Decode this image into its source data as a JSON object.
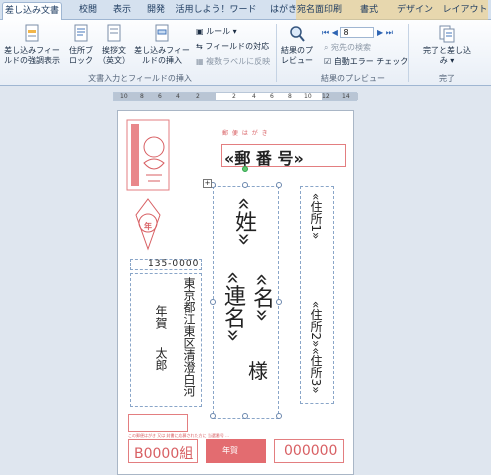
{
  "tabs": [
    "差し込み文書",
    "校閲",
    "表示",
    "開発",
    "活用しよう！ワード",
    "はがき宛名面印刷",
    "書式",
    "デザイン",
    "レイアウト"
  ],
  "ribbon": {
    "highlight_fields": "差し込みフィールドの強調表示",
    "address_block": "住所ブロック",
    "greeting_line": "挨拶文（英文）",
    "insert_merge_field": "差し込みフィールドの挿入",
    "rules": "ルール",
    "match_fields": "フィールドの対応",
    "update_labels": "複数ラベルに反映",
    "group_write_insert": "文書入力とフィールドの挿入",
    "preview_results": "結果のプレビュー",
    "record_number": "8",
    "find_recipient": "宛先の検索",
    "auto_check_errors": "自動エラー チェック",
    "group_preview": "結果のプレビュー",
    "finish_merge": "完了と差し込み",
    "group_finish": "完了"
  },
  "ruler_ticks": [
    "10",
    "8",
    "6",
    "4",
    "2",
    "2",
    "4",
    "6",
    "8",
    "10",
    "12",
    "14"
  ],
  "postcard": {
    "header": "郵 便 は が き",
    "postal_field": "«郵 番 号»",
    "sender_zip": "135-0000",
    "sender_address": "東京都江東区清澄白河",
    "sender_name_1": "年賀",
    "sender_name_2": "太郎",
    "recipient_surname": "«姓»",
    "recipient_given": "«名»",
    "recipient_joint": "«連名»",
    "honorific": "様",
    "address1": "«住所1»",
    "address23": "«住所2»«住所3»",
    "lottery_left": "B0000組",
    "lottery_right": "000000",
    "lottery_center": "年賀",
    "top_stamp_mark": "年",
    "footer_note": "この郵便はがき 又は 封書に応募された方に 当選番号 ..."
  }
}
